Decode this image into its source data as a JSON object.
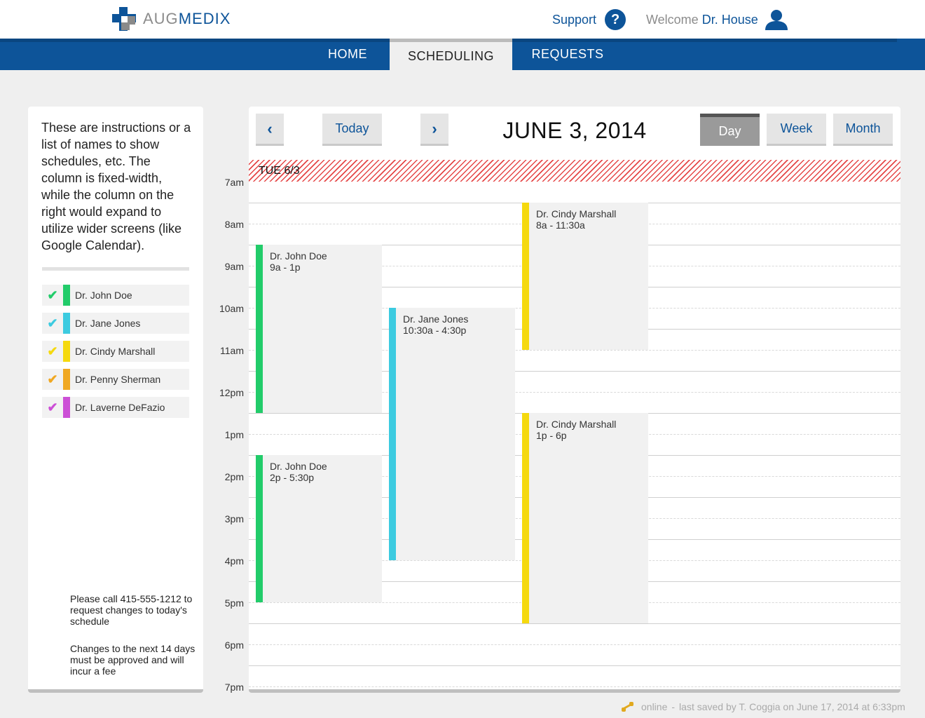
{
  "brand": {
    "part1": "AUG",
    "part2": "MEDIX",
    "colors": {
      "primary": "#0d5499",
      "gray": "#8a8a8a"
    }
  },
  "header": {
    "support_label": "Support",
    "support_icon": "?",
    "welcome_label": "Welcome",
    "user_name": "Dr. House"
  },
  "nav": {
    "items": [
      {
        "label": "HOME"
      },
      {
        "label": "SCHEDULING"
      },
      {
        "label": "REQUESTS"
      }
    ],
    "active": "SCHEDULING"
  },
  "sidebar": {
    "instructions": "These are instructions or a list of names to show schedules, etc. The column is fixed-width, while the column on the right would expand to utilize wider screens (like Google Calendar).",
    "doctors": [
      {
        "name": "Dr. John Doe",
        "color": "#22cc6a"
      },
      {
        "name": "Dr. Jane Jones",
        "color": "#3ccbe0"
      },
      {
        "name": "Dr. Cindy Marshall",
        "color": "#f5d90e"
      },
      {
        "name": "Dr. Penny Sherman",
        "color": "#f0a822"
      },
      {
        "name": "Dr. Laverne DeFazio",
        "color": "#cc4fd6"
      }
    ],
    "check_icon": "✔",
    "note1": "Please call 415-555-1212 to request changes to today's schedule",
    "note2": "Changes to the next 14 days must be approved and will incur a fee"
  },
  "calendar": {
    "prev_icon": "‹",
    "next_icon": "›",
    "today_label": "Today",
    "date_title": "JUNE 3, 2014",
    "views": {
      "day": "Day",
      "week": "Week",
      "month": "Month"
    },
    "active_view": "Day",
    "day_header": "TUE 6/3",
    "hours": [
      "7am",
      "8am",
      "9am",
      "10am",
      "11am",
      "12pm",
      "1pm",
      "2pm",
      "3pm",
      "4pm",
      "5pm",
      "6pm",
      "7pm"
    ],
    "events": [
      {
        "doctor": "Dr. John Doe",
        "time": "9a - 1p",
        "start": 9,
        "end": 13,
        "column": 0,
        "color": "#22cc6a"
      },
      {
        "doctor": "Dr. John Doe",
        "time": "2p - 5:30p",
        "start": 14,
        "end": 17.5,
        "column": 0,
        "color": "#22cc6a"
      },
      {
        "doctor": "Dr. Jane Jones",
        "time": "10:30a - 4:30p",
        "start": 10.5,
        "end": 16.5,
        "column": 1,
        "color": "#3ccbe0"
      },
      {
        "doctor": "Dr. Cindy Marshall",
        "time": "8a - 11:30a",
        "start": 8,
        "end": 11.5,
        "column": 2,
        "color": "#f5d90e"
      },
      {
        "doctor": "Dr. Cindy Marshall",
        "time": "1p - 6p",
        "start": 13,
        "end": 18,
        "column": 2,
        "color": "#f5d90e"
      }
    ]
  },
  "footer": {
    "status": "online",
    "separator": "-",
    "saved_text": "last saved by T. Coggia on June 17, 2014 at 6:33pm",
    "icon_color": "#e1a91f"
  }
}
